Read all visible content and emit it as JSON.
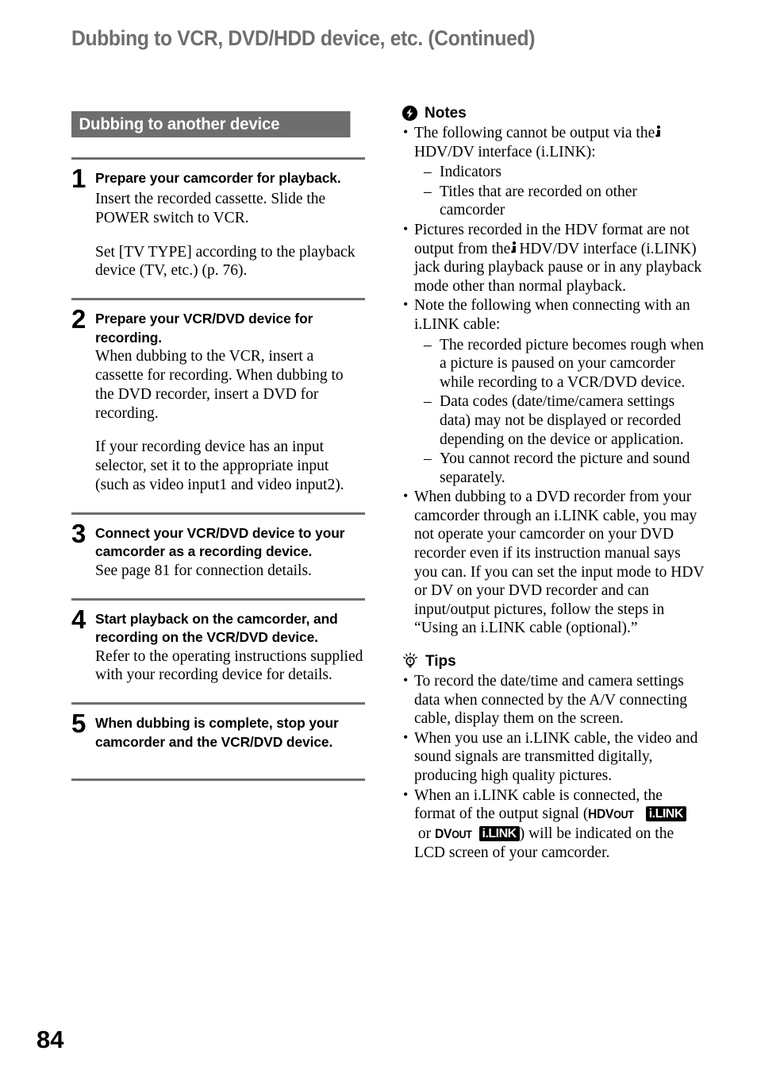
{
  "running_head": "Dubbing to VCR, DVD/HDD device, etc. (Continued)",
  "section": {
    "title": "Dubbing to another device"
  },
  "steps": [
    {
      "number": "1",
      "title": "Prepare your camcorder for playback.",
      "paragraphs": [
        "Insert the recorded cassette. Slide the POWER switch to VCR.",
        "Set [TV TYPE] according to the playback device (TV, etc.) (p. 76)."
      ]
    },
    {
      "number": "2",
      "title": "Prepare your VCR/DVD device for recording.",
      "paragraphs": [
        "When dubbing to the VCR, insert a cassette for recording. When dubbing to the DVD recorder, insert a DVD for recording.",
        "If your recording device has an input selector, set it to the appropriate input (such as video input1 and video input2)."
      ]
    },
    {
      "number": "3",
      "title": "Connect your VCR/DVD device to your camcorder as a recording device.",
      "paragraphs": [
        "See page 81 for connection details."
      ]
    },
    {
      "number": "4",
      "title": "Start playback on the camcorder, and recording on the VCR/DVD device.",
      "paragraphs": [
        "Refer to the operating instructions supplied with your recording device for details."
      ]
    },
    {
      "number": "5",
      "title": "When dubbing is complete, stop your camcorder and the VCR/DVD device.",
      "paragraphs": []
    }
  ],
  "notes": {
    "heading": "Notes",
    "icon": "note-exclamation-icon",
    "b1_part1": "The following cannot be output via the",
    "b1_part2": "HDV/DV interface (i.LINK):",
    "b1_sub": [
      "Indicators",
      "Titles that are recorded on other camcorder"
    ],
    "b2_part1": "Pictures recorded in the HDV format are not output from the",
    "b2_part2": "HDV/DV interface (i.LINK) jack during playback pause or in any playback mode other than normal playback.",
    "b3": "Note the following when connecting with an i.LINK cable:",
    "b3_sub": [
      "The recorded picture becomes rough when a picture is paused on your camcorder while recording to a VCR/DVD device.",
      "Data codes (date/time/camera settings data) may not be displayed or recorded depending on the device or application.",
      "You cannot record the picture and sound separately."
    ],
    "b4": "When dubbing to a DVD recorder from your camcorder through an i.LINK cable, you may not operate your camcorder on your DVD recorder even if its instruction manual says you can. If you can set the input mode to HDV or DV on your DVD recorder and can input/output pictures, follow the steps in “Using an i.LINK cable (optional).”"
  },
  "tips": {
    "heading": "Tips",
    "icon": "lightbulb-icon",
    "b1": "To record the date/time and camera settings data when connected by the A/V connecting cable, display them on the screen.",
    "b2": "When you use an i.LINK cable, the video and sound signals are transmitted digitally, producing high quality pictures.",
    "b3_part1": "When an i.LINK cable is connected, the format of the output signal (",
    "b3_badge1_main": "HDV",
    "b3_badge1_sub": "OUT",
    "b3_badge2": "i.LINK",
    "b3_or": "or",
    "b3_badge3_main": "DV",
    "b3_badge3_sub": "OUT",
    "b3_badge4": "i.LINK",
    "b3_part2": ") will be indicated on the LCD screen of your camcorder."
  },
  "folio": "84",
  "colors": {
    "accent_gray": "#6e6e6e",
    "text": "#000000",
    "background": "#ffffff"
  }
}
